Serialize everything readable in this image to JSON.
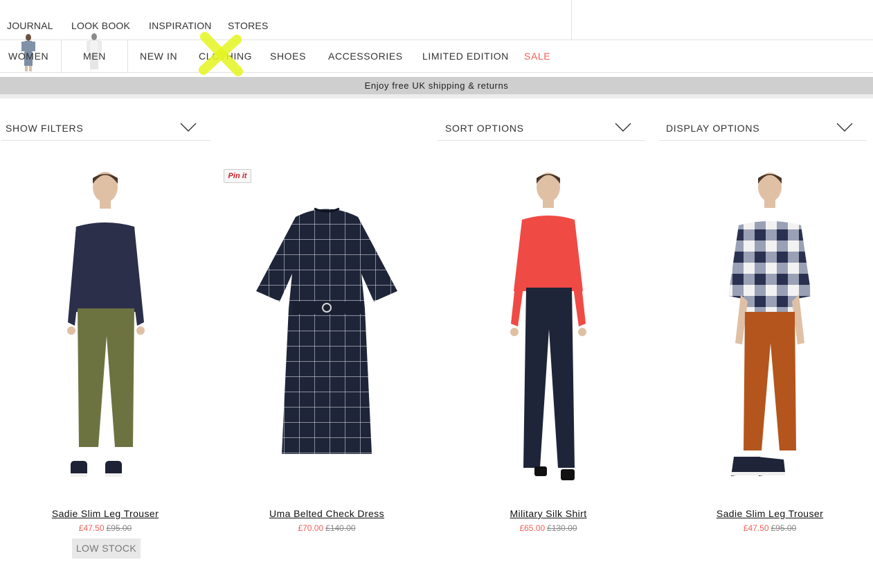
{
  "top_nav": {
    "items": [
      "JOURNAL",
      "LOOK BOOK",
      "INSPIRATION",
      "STORES"
    ]
  },
  "main_nav": {
    "women": "WOMEN",
    "men": "MEN",
    "items": [
      "NEW IN",
      "CLOTHING",
      "SHOES",
      "ACCESSORIES",
      "LIMITED EDITION",
      "SALE"
    ]
  },
  "promo": {
    "text": "Enjoy free UK shipping & returns"
  },
  "controls": {
    "filters": "SHOW FILTERS",
    "sort": "SORT OPTIONS",
    "display": "DISPLAY OPTIONS"
  },
  "pin_it": "Pin it",
  "products": [
    {
      "name": "Sadie Slim Leg Trouser",
      "price": "£47.50",
      "was": "£95.00",
      "stock": "LOW STOCK"
    },
    {
      "name": "Uma Belted Check Dress",
      "price": "£70.00",
      "was": "£140.00"
    },
    {
      "name": "Military Silk Shirt",
      "price": "£65.00",
      "was": "£130.00"
    },
    {
      "name": "Sadie Slim Leg Trouser",
      "price": "£47.50",
      "was": "£95.00"
    }
  ],
  "colors": {
    "accent_sale": "#f25f57",
    "promo_bar": "#cfcfcf",
    "highlight_x": "#e4f522"
  }
}
